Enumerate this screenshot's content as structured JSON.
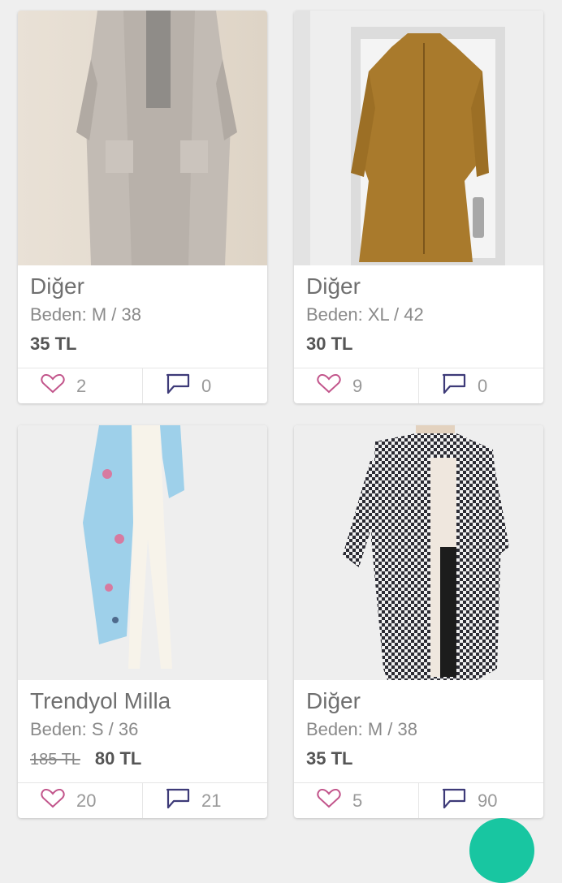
{
  "products": [
    {
      "brand": "Diğer",
      "size": "Beden: M / 38",
      "old_price": "",
      "price": "35 TL",
      "likes": "2",
      "comments": "0"
    },
    {
      "brand": "Diğer",
      "size": "Beden: XL / 42",
      "old_price": "",
      "price": "30 TL",
      "likes": "9",
      "comments": "0"
    },
    {
      "brand": "Trendyol Milla",
      "size": "Beden: S / 36",
      "old_price": "185 TL",
      "price": "80 TL",
      "likes": "20",
      "comments": "21"
    },
    {
      "brand": "Diğer",
      "size": "Beden: M / 38",
      "old_price": "",
      "price": "35 TL",
      "likes": "5",
      "comments": "90"
    }
  ],
  "icons": {
    "like": "heart-icon",
    "comment": "comment-bubble-icon"
  },
  "colors": {
    "accent": "#18c6a1",
    "like_icon": "#c2558b",
    "comment_icon": "#3d3a78"
  }
}
